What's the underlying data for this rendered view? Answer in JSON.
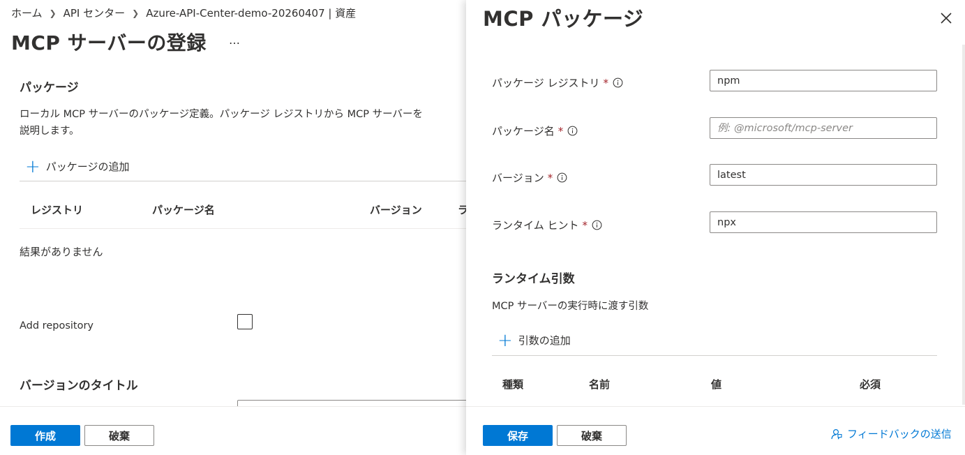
{
  "breadcrumb": [
    "ホーム",
    "API センター",
    "Azure-API-Center-demo-20260407 | 資産"
  ],
  "page_title": "MCP サーバーの登録",
  "more_label": "…",
  "packages_section": {
    "title": "パッケージ",
    "description_line1": "ローカル MCP サーバーのパッケージ定義。パッケージ レジストリから MCP サーバーを",
    "description_line2": "説明します。",
    "add_label": "パッケージの追加",
    "columns": [
      "レジストリ",
      "パッケージ名",
      "バージョン",
      "ラ"
    ],
    "empty_text": "結果がありません"
  },
  "add_repository_label": "Add repository",
  "version_title_label": "バージョンのタイトル",
  "left_footer": {
    "create_label": "作成",
    "discard_label": "破棄"
  },
  "panel": {
    "title": "MCP パッケージ",
    "fields": [
      {
        "label": "パッケージ レジストリ",
        "value": "npm",
        "placeholder": ""
      },
      {
        "label": "パッケージ名",
        "value": "",
        "placeholder": "例: @microsoft/mcp-server"
      },
      {
        "label": "バージョン",
        "value": "latest",
        "placeholder": ""
      },
      {
        "label": "ランタイム ヒント",
        "value": "npx",
        "placeholder": ""
      }
    ],
    "required_mark": "*",
    "runtime_args": {
      "title": "ランタイム引数",
      "description": "MCP サーバーの実行時に渡す引数",
      "add_label": "引数の追加",
      "columns": [
        "種類",
        "名前",
        "値",
        "必須"
      ]
    },
    "footer": {
      "save_label": "保存",
      "discard_label": "破棄",
      "feedback_label": "フィードバックの送信"
    }
  },
  "colors": {
    "accent": "#0078d4",
    "required": "#a4262c",
    "text": "#323130",
    "border": "#8a8886"
  },
  "icons": [
    "chevron-right-icon",
    "more-icon",
    "add-icon",
    "close-icon",
    "info-icon",
    "feedback-icon"
  ]
}
